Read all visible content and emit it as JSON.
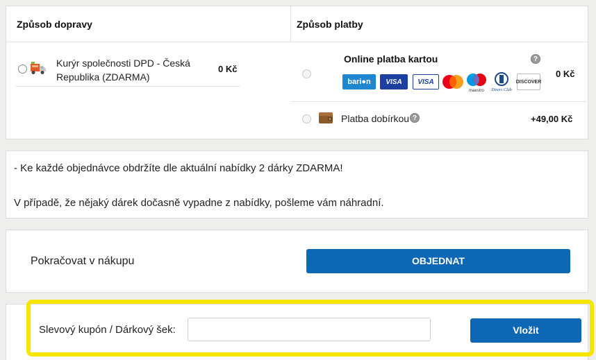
{
  "shipping": {
    "title": "Způsob dopravy",
    "options": [
      {
        "icon": "delivery-truck-icon",
        "label_line1": "Kurýr společnosti DPD - Česká",
        "label_line2": "Republika (ZDARMA)",
        "price": "0 Kč"
      }
    ]
  },
  "payment": {
    "title": "Způsob platby",
    "options": [
      {
        "label": "Online platba kartou",
        "price": "0 Kč",
        "logos": [
          {
            "name": "barion-logo",
            "text": "bari●n",
            "bg": "#1e87cf"
          },
          {
            "name": "visa-logo",
            "text": "VISA",
            "bg": "#1a3fa0"
          },
          {
            "name": "visa-electron-logo",
            "text": "VISA",
            "bg": "#1a3fa0"
          },
          {
            "name": "mastercard-logo",
            "text": "",
            "bg": "#ffffff"
          },
          {
            "name": "maestro-logo",
            "text": "maestro",
            "bg": "#ffffff"
          },
          {
            "name": "diners-club-logo",
            "text": "Diners Club",
            "bg": "#ffffff"
          },
          {
            "name": "discover-logo",
            "text": "DISCOVER",
            "bg": "#ffffff"
          }
        ]
      },
      {
        "icon": "wallet-icon",
        "label": "Platba dobírkou",
        "price": "+49,00 Kč"
      }
    ],
    "help_symbol": "?"
  },
  "info": {
    "line1": "- Ke každé objednávce obdržíte dle aktuální nabídky 2 dárky ZDARMA!",
    "line2": "V případě, že nějaký dárek dočasně vypadne z nabídky, pošleme vám náhradní."
  },
  "actions": {
    "continue_label": "Pokračovat v nákupu",
    "order_label": "OBJEDNAT"
  },
  "coupon": {
    "label": "Slevový kupón / Dárkový šek:",
    "value": "",
    "apply_label": "Vložit"
  },
  "colors": {
    "primary_button": "#0d67b4",
    "highlight": "#f5e600"
  }
}
